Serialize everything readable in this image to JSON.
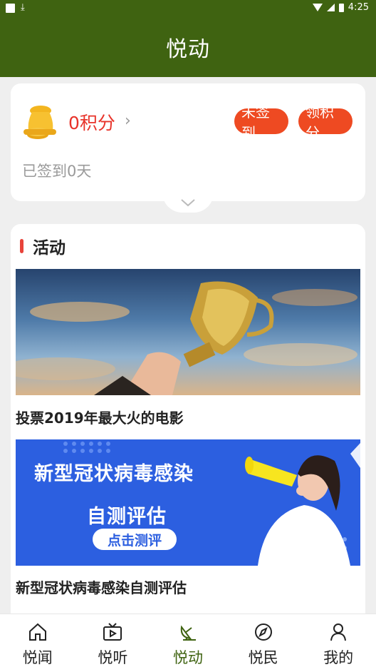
{
  "status_bar": {
    "time": "4:25"
  },
  "header": {
    "title": "悦动"
  },
  "points": {
    "value": "0积分",
    "chevron": "›",
    "unsigned_label": "未签到",
    "claim_label": "领积分",
    "signed_days": "已签到0天"
  },
  "activity": {
    "section_title": "活动",
    "items": [
      {
        "title": "投票2019年最大火的电影"
      },
      {
        "title": "新型冠状病毒感染自测评估",
        "banner_headline": "新型冠状病毒感染",
        "banner_sub": "自测评估",
        "banner_cta": "点击测评"
      }
    ]
  },
  "nav": {
    "items": [
      {
        "label": "悦闻",
        "icon": "home-icon"
      },
      {
        "label": "悦听",
        "icon": "tv-icon"
      },
      {
        "label": "悦动",
        "icon": "satellite-dish-icon",
        "active": true
      },
      {
        "label": "悦民",
        "icon": "compass-icon"
      },
      {
        "label": "我的",
        "icon": "user-icon"
      }
    ]
  },
  "colors": {
    "brand_green": "#3f6311",
    "accent_red": "#e8332a",
    "pill_orange": "#ee4a22",
    "banner_blue": "#2c5fe0"
  }
}
